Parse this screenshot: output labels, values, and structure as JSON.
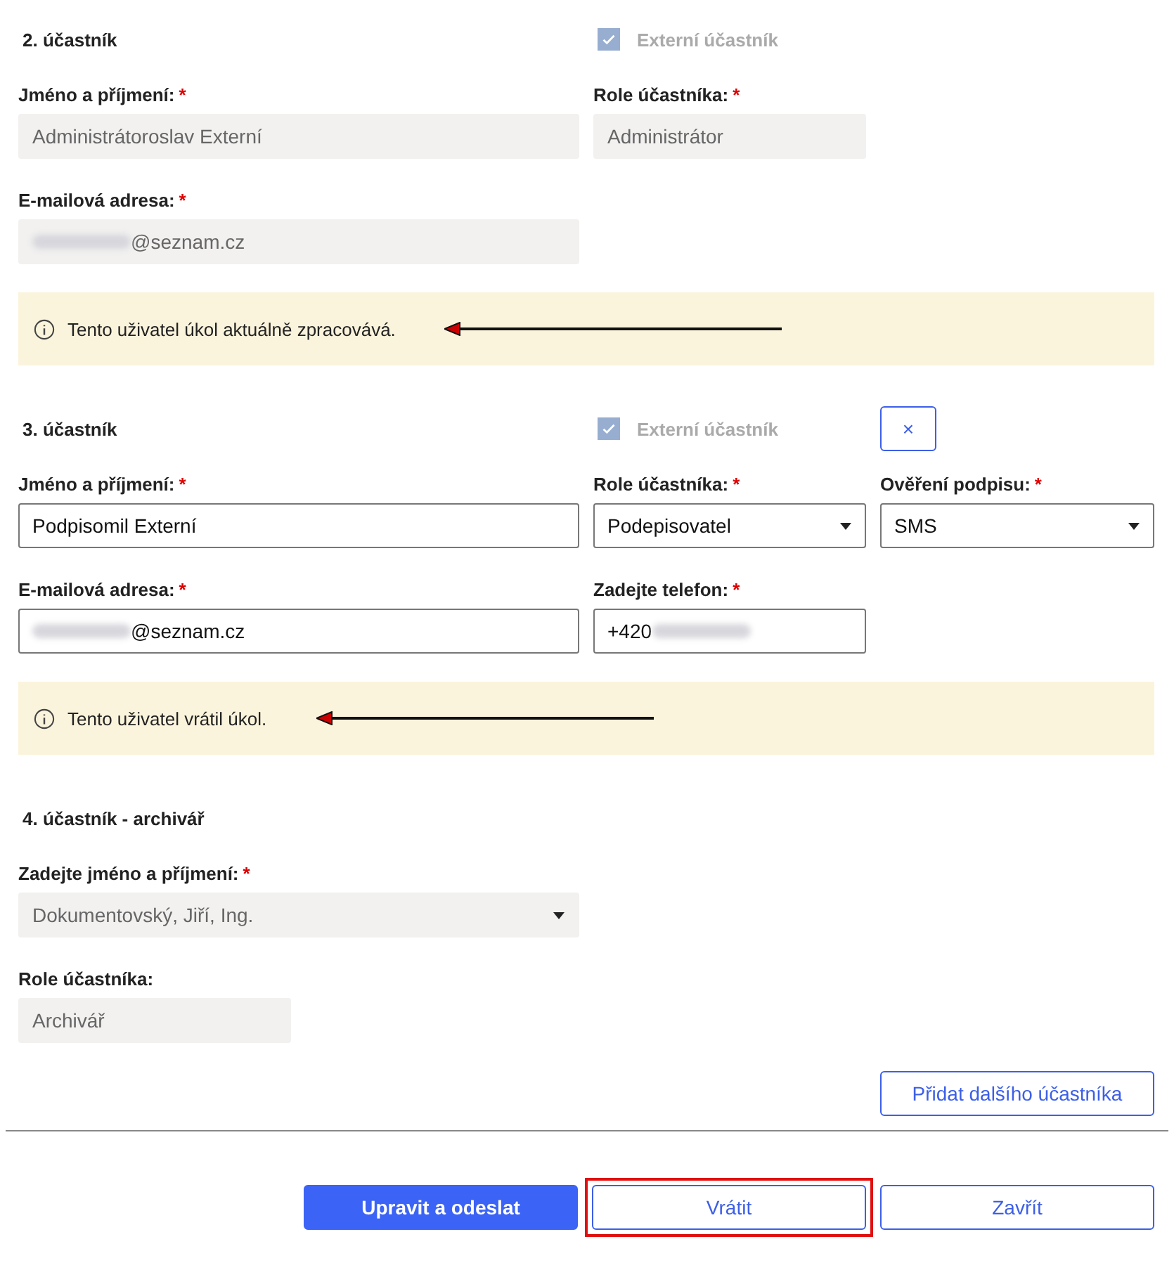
{
  "participants": [
    {
      "title": "2. účastník",
      "external": {
        "label": "Externí účastník",
        "checked": true,
        "disabled": true
      },
      "rows": [
        [
          {
            "label": "Jméno a příjmení:",
            "required_mark": "*",
            "kind": "text",
            "value": "Administrátoroslav Externí",
            "disabled": true
          },
          {
            "label": "Role účastníka:",
            "required_mark": "*",
            "kind": "text",
            "value": "Administrátor",
            "disabled": true
          }
        ],
        [
          {
            "label": "E-mailová adresa:",
            "required_mark": "*",
            "kind": "text",
            "value": "@seznam.cz",
            "blurred_before": true,
            "disabled": true
          }
        ]
      ],
      "notice": {
        "text": "Tento uživatel úkol aktuálně zpracovává.",
        "arrow": true
      }
    },
    {
      "title": "3. účastník",
      "external": {
        "label": "Externí účastník",
        "checked": true,
        "disabled": true
      },
      "remove_button": "×",
      "rows": [
        [
          {
            "label": "Jméno a příjmení:",
            "required_mark": "*",
            "kind": "text",
            "value": "Podpisomil Externí",
            "disabled": false
          },
          {
            "label": "Role účastníka:",
            "required_mark": "*",
            "kind": "select",
            "value": "Podepisovatel",
            "disabled": false
          },
          {
            "label": "Ověření podpisu:",
            "required_mark": "*",
            "kind": "select",
            "value": "SMS",
            "disabled": false
          }
        ],
        [
          {
            "label": "E-mailová adresa:",
            "required_mark": "*",
            "kind": "text",
            "value": "@seznam.cz",
            "blurred_before": true,
            "disabled": false
          },
          {
            "label": "Zadejte telefon:",
            "required_mark": "*",
            "kind": "text",
            "value": "+420",
            "blurred_after": true,
            "disabled": false
          }
        ]
      ],
      "notice": {
        "text": "Tento uživatel vrátil úkol.",
        "arrow": true
      }
    },
    {
      "title": "4. účastník - archivář",
      "rows": [
        [
          {
            "label": "Zadejte jméno a příjmení:",
            "required_mark": "*",
            "kind": "select",
            "value": "Dokumentovský, Jiří, Ing.",
            "disabled": true
          }
        ],
        [
          {
            "label": "Role účastníka:",
            "kind": "static",
            "value": "Archivář",
            "disabled": true
          }
        ]
      ]
    }
  ],
  "add_button": "Přidat dalšího účastníka",
  "footer_buttons": [
    {
      "label": "Upravit a odeslat",
      "kind": "primary",
      "highlighted": false
    },
    {
      "label": "Vrátit",
      "kind": "secondary",
      "highlighted": true
    },
    {
      "label": "Zavřít",
      "kind": "secondary",
      "highlighted": false
    }
  ]
}
